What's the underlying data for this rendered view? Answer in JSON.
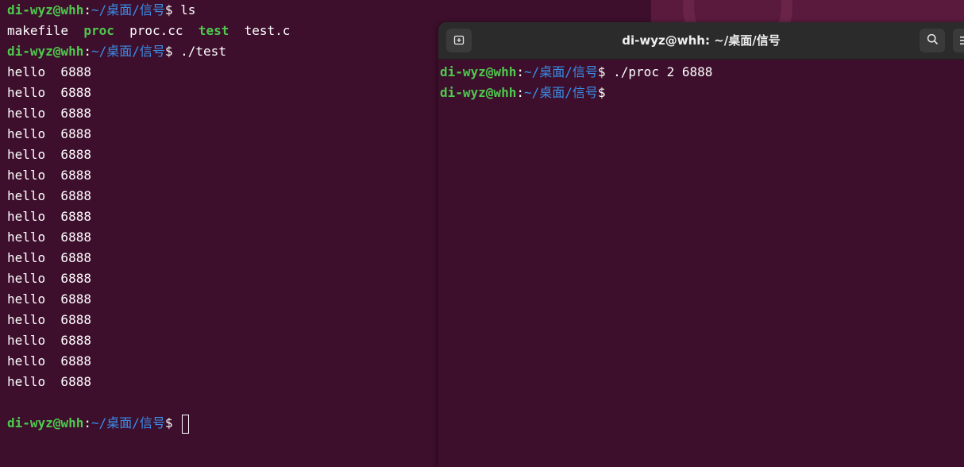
{
  "prompt": {
    "user": "di-wyz@whh",
    "colon": ":",
    "path": "~/桌面/信号",
    "dollar": "$"
  },
  "left_terminal": {
    "cmd_ls": " ls",
    "ls_output": {
      "makefile": "makefile",
      "proc": "proc",
      "proc_cc": "proc.cc",
      "test": "test",
      "test_c": "test.c"
    },
    "cmd_run": " ./test",
    "output_lines": [
      "hello  6888",
      "hello  6888",
      "hello  6888",
      "hello  6888",
      "hello  6888",
      "hello  6888",
      "hello  6888",
      "hello  6888",
      "hello  6888",
      "hello  6888",
      "hello  6888",
      "hello  6888",
      "hello  6888",
      "hello  6888",
      "hello  6888",
      "hello  6888"
    ]
  },
  "right_terminal": {
    "title": "di-wyz@whh: ~/桌面/信号",
    "cmd_run": " ./proc 2 6888"
  },
  "icons": {
    "new_tab": "new-tab-icon",
    "search": "search-icon",
    "menu": "hamburger-menu-icon"
  },
  "colors": {
    "background": "#3d0f2c",
    "prompt_user": "#4ec94e",
    "prompt_path": "#3b8ee8",
    "headerbar": "#2b2b2b"
  }
}
